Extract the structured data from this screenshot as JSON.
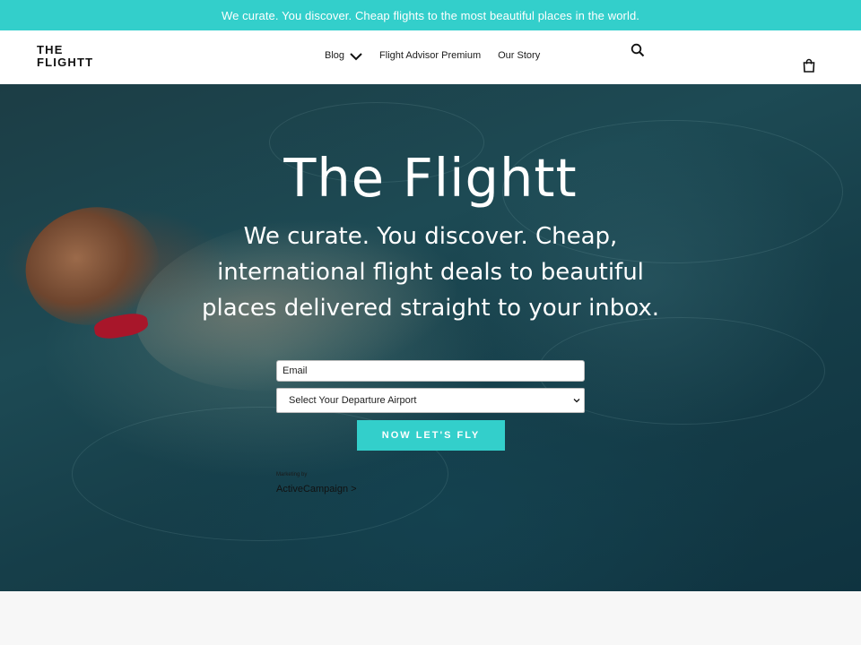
{
  "announcement": "We curate. You discover. Cheap flights to the most beautiful places in the world.",
  "header": {
    "logo_line1": "THE",
    "logo_line2": "FLIGHTT",
    "nav": [
      {
        "label": "Blog",
        "has_dropdown": true
      },
      {
        "label": "Flight Advisor Premium"
      },
      {
        "label": "Our Story"
      }
    ],
    "icons": {
      "search": "search-icon",
      "cart": "shopping-bag-icon",
      "dropdown": "chevron-down-icon"
    }
  },
  "hero": {
    "title": "The Flightt",
    "subtitle": "We curate. You discover. Cheap, international flight deals to beautiful places delivered straight to your inbox."
  },
  "form": {
    "email_placeholder": "Email",
    "airport_select_value": "Select Your Departure Airport",
    "submit_label": "NOW LET'S FLY"
  },
  "marketing": {
    "small_text": "Marketing by",
    "brand": "ActiveCampaign >"
  },
  "colors": {
    "accent": "#33cfcb",
    "header_bg": "#ffffff",
    "text_dark": "#111111"
  }
}
